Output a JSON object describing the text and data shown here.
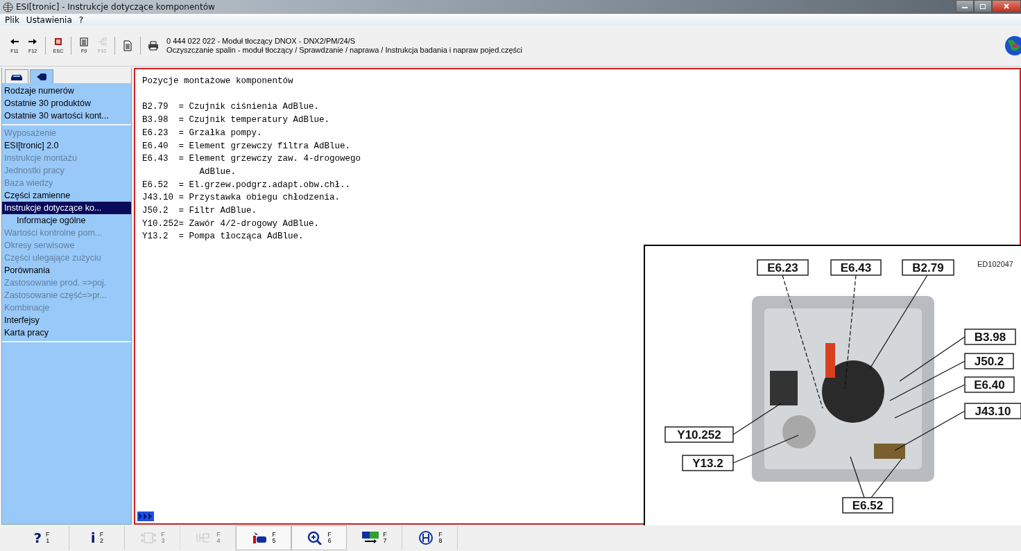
{
  "window": {
    "title": "ESI[tronic] - Instrukcje dotyczące komponentów"
  },
  "menu": [
    "Plik",
    "Ustawienia",
    "?"
  ],
  "toolbar": {
    "buttons": [
      {
        "kind": "back",
        "key": "F11",
        "disabled": false
      },
      {
        "kind": "forward",
        "key": "F12",
        "disabled": false
      },
      {
        "kind": "exit",
        "key": "ESC",
        "disabled": false
      },
      {
        "kind": "list",
        "key": "F9",
        "disabled": false
      },
      {
        "kind": "tree",
        "key": "F10",
        "disabled": true
      },
      {
        "kind": "document",
        "disabled": false
      },
      {
        "kind": "print",
        "disabled": false
      }
    ],
    "info": [
      "0 444 022 022 - Moduł tłoczący DNOX - DNX2/PM/24/S",
      "Oczyszczanie spalin - moduł tłoczący / Sprawdzanie / naprawa / Instrukcja badania i napraw pojed.części"
    ]
  },
  "sidebar": {
    "tabs": [
      {
        "kind": "car",
        "selected": false
      },
      {
        "kind": "part",
        "selected": true
      }
    ],
    "groups": [
      [
        {
          "label": "Rodzaje numerów",
          "disabled": false,
          "selected": false
        },
        {
          "label": "Ostatnie 30 produktów",
          "disabled": false,
          "selected": false
        },
        {
          "label": "Ostatnie 30 wartości kont...",
          "disabled": false,
          "selected": false
        }
      ],
      [
        {
          "label": "Wyposażenie",
          "disabled": true,
          "selected": false
        },
        {
          "label": "ESI[tronic] 2.0",
          "disabled": false,
          "selected": false
        },
        {
          "label": "Instrukcje montażu",
          "disabled": true,
          "selected": false
        },
        {
          "label": "Jednostki pracy",
          "disabled": true,
          "selected": false
        },
        {
          "label": "Baza wiedzy",
          "disabled": true,
          "selected": false
        },
        {
          "label": "Części zamienne",
          "disabled": false,
          "selected": false
        },
        {
          "label": "Instrukcje dotyczące ko...",
          "disabled": false,
          "selected": true,
          "children": [
            {
              "label": "Informacje ogólne",
              "disabled": false,
              "selected": false
            }
          ]
        },
        {
          "label": "Wartości kontrolne pom...",
          "disabled": true,
          "selected": false
        },
        {
          "label": "Okresy serwisowe",
          "disabled": true,
          "selected": false
        },
        {
          "label": "Części ulegające zużyciu",
          "disabled": true,
          "selected": false
        },
        {
          "label": "Porównania",
          "disabled": false,
          "selected": false
        },
        {
          "label": "Zastosowanie prod. =>poj.",
          "disabled": true,
          "selected": false
        },
        {
          "label": "Zastosowanie część=>pr...",
          "disabled": true,
          "selected": false
        },
        {
          "label": "Kombinacje",
          "disabled": true,
          "selected": false
        },
        {
          "label": "Interfejsy",
          "disabled": false,
          "selected": false
        },
        {
          "label": "Karta pracy",
          "disabled": false,
          "selected": false
        }
      ]
    ]
  },
  "document": {
    "heading": "Pozycje montażowe komponentów",
    "entries": [
      {
        "code": "B2.79",
        "desc": "= Czujnik ciśnienia AdBlue."
      },
      {
        "code": "B3.98",
        "desc": "= Czujnik temperatury AdBlue."
      },
      {
        "code": "E6.23",
        "desc": "= Grzałka pompy."
      },
      {
        "code": "E6.40",
        "desc": "= Element grzewczy filtra AdBlue."
      },
      {
        "code": "E6.43",
        "desc": "= Element grzewczy zaw. 4-drogowego AdBlue."
      },
      {
        "code": "E6.52",
        "desc": "= El.grzew.podgrz.adapt.obw.chł.."
      },
      {
        "code": "J43.10",
        "desc": "= Przystawka obiegu chłodzenia."
      },
      {
        "code": "J50.2",
        "desc": "= Filtr AdBlue."
      },
      {
        "code": "Y10.252",
        "desc": "= Zawór 4/2-drogowy AdBlue."
      },
      {
        "code": "Y13.2",
        "desc": "= Pompa tłocząca AdBlue."
      }
    ],
    "figure": {
      "code": "ED102047",
      "callouts": [
        "E6.23",
        "E6.43",
        "B2.79",
        "B3.98",
        "J50.2",
        "E6.40",
        "J43.10",
        "Y10.252",
        "Y13.2",
        "E6.52"
      ]
    }
  },
  "function_keys": [
    {
      "kind": "help",
      "glyph": "?",
      "key": "F",
      "num": "1",
      "disabled": false,
      "pressed": false
    },
    {
      "kind": "info",
      "glyph": "i",
      "key": "F",
      "num": "2",
      "disabled": false,
      "pressed": false
    },
    {
      "kind": "schematic",
      "key": "F",
      "num": "3",
      "disabled": true,
      "pressed": false
    },
    {
      "kind": "circuit",
      "key": "F",
      "num": "4",
      "disabled": true,
      "pressed": false
    },
    {
      "kind": "vehicle",
      "key": "F",
      "num": "5",
      "disabled": false,
      "pressed": true
    },
    {
      "kind": "zoom",
      "key": "F",
      "num": "6",
      "disabled": false,
      "pressed": true
    },
    {
      "kind": "kts",
      "key": "F",
      "num": "7",
      "disabled": false,
      "pressed": false
    },
    {
      "kind": "logo",
      "key": "F",
      "num": "8",
      "disabled": false,
      "pressed": false
    }
  ]
}
